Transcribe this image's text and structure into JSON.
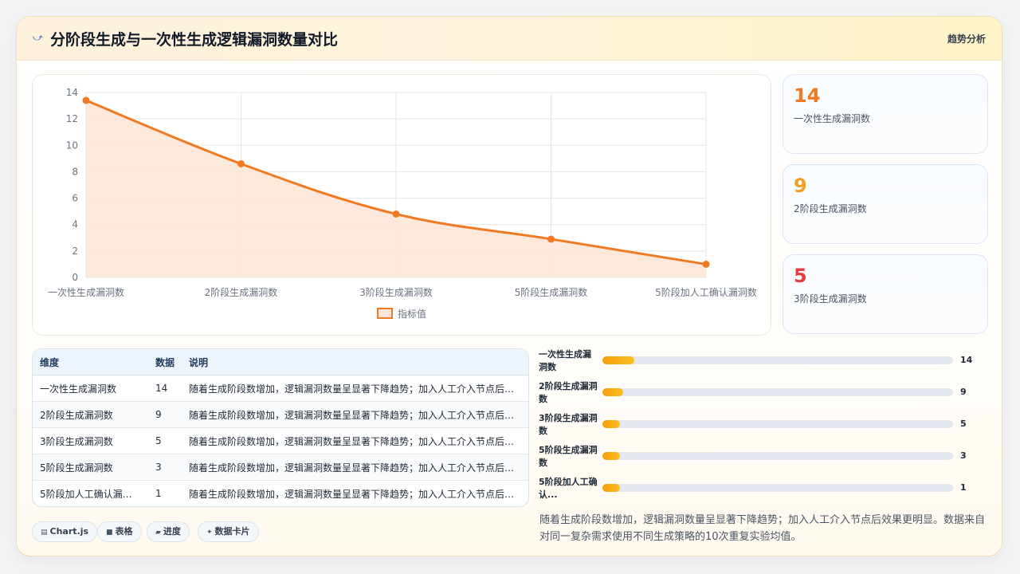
{
  "header": {
    "title": "分阶段生成与一次性生成逻辑漏洞数量对比",
    "title_icon": "chart-line-icon",
    "tag": "趋势分析"
  },
  "chart_data": {
    "type": "area",
    "categories": [
      "一次性生成漏洞数",
      "2阶段生成漏洞数",
      "3阶段生成漏洞数",
      "5阶段生成漏洞数",
      "5阶段加人工确认漏洞数"
    ],
    "series": [
      {
        "name": "指标值",
        "values": [
          13.4,
          8.6,
          4.8,
          2.9,
          1.0
        ],
        "color": "#f07a22",
        "fill": "#fde6d8"
      }
    ],
    "yticks": [
      "0",
      "2",
      "4",
      "6",
      "8",
      "10",
      "12",
      "14"
    ],
    "ylim": [
      0,
      14
    ],
    "grid": true,
    "legend": "bottom"
  },
  "stats": [
    {
      "value": "14",
      "label": "一次性生成漏洞数",
      "color": "#f07a22"
    },
    {
      "value": "9",
      "label": "2阶段生成漏洞数",
      "color": "#f0a020"
    },
    {
      "value": "5",
      "label": "3阶段生成漏洞数",
      "color": "#e53e3e"
    }
  ],
  "table": {
    "headers": [
      "维度",
      "数据",
      "说明"
    ],
    "rows": [
      [
        "一次性生成漏洞数",
        "14",
        "随着生成阶段数增加，逻辑漏洞数量呈显著下降趋势；加入人工介入节点后效果更明显。"
      ],
      [
        "2阶段生成漏洞数",
        "9",
        "随着生成阶段数增加，逻辑漏洞数量呈显著下降趋势；加入人工介入节点后效果更明显。"
      ],
      [
        "3阶段生成漏洞数",
        "5",
        "随着生成阶段数增加，逻辑漏洞数量呈显著下降趋势；加入人工介入节点后效果更明显。"
      ],
      [
        "5阶段生成漏洞数",
        "3",
        "随着生成阶段数增加，逻辑漏洞数量呈显著下降趋势；加入人工介入节点后效果更明显。"
      ],
      [
        "5阶段加人工确认漏洞数",
        "1",
        "随着生成阶段数增加，逻辑漏洞数量呈显著下降趋势；加入人工介入节点后效果更明显。"
      ]
    ]
  },
  "tags": [
    {
      "icon": "chart-icon",
      "label": "Chart.js"
    },
    {
      "icon": "table-icon",
      "label": "表格"
    },
    {
      "icon": "progress-icon",
      "label": "进度"
    },
    {
      "icon": "sparkle-icon",
      "label": "数据卡片"
    }
  ],
  "progress": {
    "max": 14,
    "items": [
      {
        "label": "一次性生成漏洞数",
        "value": 14,
        "display": "14",
        "fill_fraction": 0.09
      },
      {
        "label": "2阶段生成漏洞数",
        "value": 9,
        "display": "9",
        "fill_fraction": 0.06
      },
      {
        "label": "3阶段生成漏洞数",
        "value": 5,
        "display": "5",
        "fill_fraction": 0.05
      },
      {
        "label": "5阶段生成漏洞数",
        "value": 3,
        "display": "3",
        "fill_fraction": 0.05
      },
      {
        "label": "5阶段加人工确认...",
        "value": 1,
        "display": "1",
        "fill_fraction": 0.05
      }
    ]
  },
  "note": "随着生成阶段数增加，逻辑漏洞数量呈显著下降趋势；加入人工介入节点后效果更明显。数据来自对同一复杂需求使用不同生成策略的10次重复实验均值。"
}
